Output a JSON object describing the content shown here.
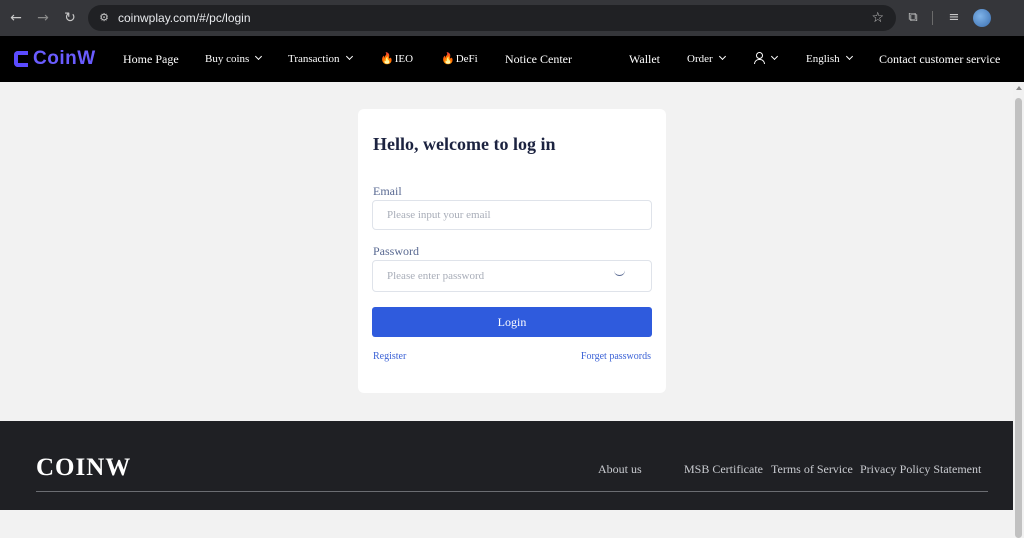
{
  "browser": {
    "url": "coinwplay.com/#/pc/login",
    "icons": [
      "back-icon",
      "forward-icon",
      "reload-icon",
      "site-info-icon",
      "bookmark-star-icon",
      "extensions-icon",
      "media-icon",
      "profile-icon"
    ]
  },
  "header": {
    "logo_text": "CoinW",
    "nav": {
      "home": "Home Page",
      "buy_coins": "Buy coins",
      "transaction": "Transaction",
      "ieo": "IEO",
      "defi": "DeFi",
      "notice": "Notice Center",
      "wallet": "Wallet",
      "order": "Order",
      "language": "English",
      "contact": "Contact customer service"
    },
    "accent_color": "#5b4bff"
  },
  "login": {
    "title": "Hello, welcome to log in",
    "email_label": "Email",
    "email_placeholder": "Please input your email",
    "password_label": "Password",
    "password_placeholder": "Please enter password",
    "login_button": "Login",
    "register_link": "Register",
    "forgot_link": "Forget passwords",
    "button_color": "#2f5bdd"
  },
  "footer": {
    "brand": "COINW",
    "links": {
      "about": "About us",
      "msb": "MSB Certificate",
      "terms": "Terms of Service",
      "privacy": "Privacy Policy Statement"
    }
  }
}
